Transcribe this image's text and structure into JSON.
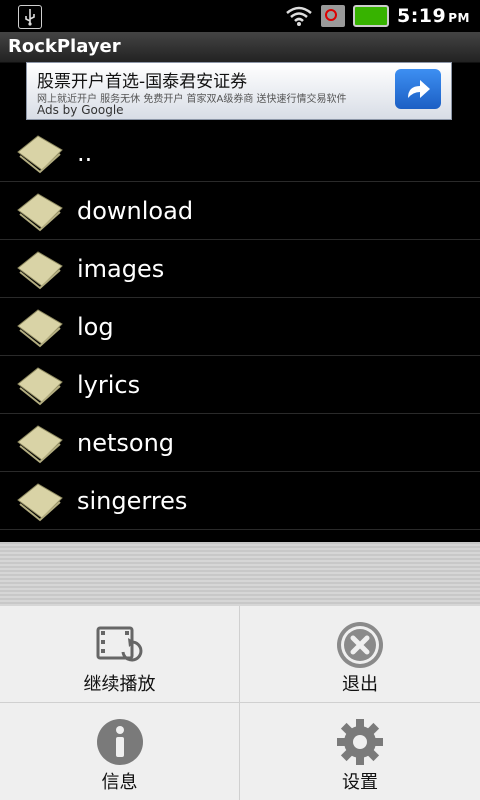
{
  "status_bar": {
    "time": "5:19",
    "ampm": "PM"
  },
  "app": {
    "title": "RockPlayer"
  },
  "ad": {
    "headline": "股票开户首选-国泰君安证券",
    "description": "网上就近开户 服务无休 免费开户 首家双A级券商 送快速行情交易软件",
    "byline": "Ads by Google"
  },
  "list": {
    "items": [
      {
        "label": ".."
      },
      {
        "label": "download"
      },
      {
        "label": "images"
      },
      {
        "label": "log"
      },
      {
        "label": "lyrics"
      },
      {
        "label": "netsong"
      },
      {
        "label": "singerres"
      }
    ]
  },
  "menu": {
    "resume_label": "继续播放",
    "exit_label": "退出",
    "info_label": "信息",
    "settings_label": "设置"
  }
}
